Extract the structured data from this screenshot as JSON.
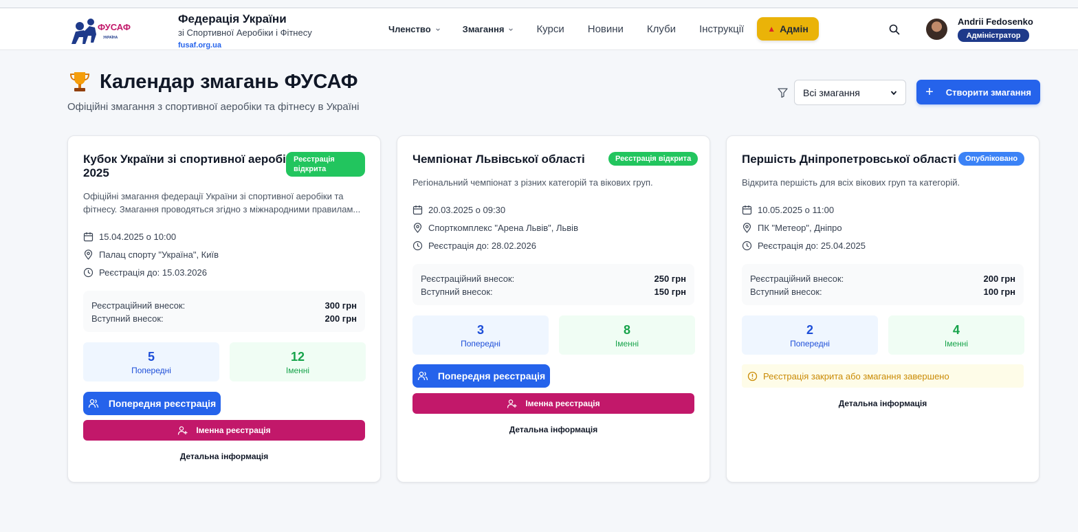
{
  "header": {
    "logo_text": "ФУСАФ",
    "logo_sub": "УКРАЇНА",
    "brand_title": "Федерація України",
    "brand_subtitle": "зі Спортивної Аеробіки і Фітнесу",
    "brand_url": "fusaf.org.ua",
    "nav": {
      "membership": "Членство",
      "competitions": "Змагання",
      "courses": "Курси",
      "news": "Новини",
      "clubs": "Клуби",
      "instructions": "Інструкції"
    },
    "admin_label": "Адмін",
    "user_name": "Andrii Fedosenko",
    "user_role": "Адміністратор"
  },
  "page": {
    "title": "Календар змагань ФУСАФ",
    "subtitle": "Офіційні змагання з спортивної аеробіки та фітнесу в Україні",
    "filter_selected": "Всі змагання",
    "create_label": "Створити змагання"
  },
  "labels": {
    "fee_registration": "Реєстраційний внесок:",
    "fee_entry": "Вступний внесок:",
    "stat_preliminary": "Попередні",
    "stat_named": "Іменні",
    "btn_preliminary": "Попередня реєстрація",
    "btn_named": "Іменна реєстрація",
    "details": "Детальна інформація"
  },
  "cards": [
    {
      "title_line1": "Кубок України зі спортивної аеробіки",
      "title_line2": "2025",
      "badge_line1": "Реєстрація",
      "badge_line2": "відкрита",
      "status_color": "#22c55e",
      "desc_line1": "Офіційні змагання федерації України зі спортивної аеробіки та",
      "desc_line2": "фітнесу. Змагання проводяться згідно з міжнародними правилам...",
      "date": "15.04.2025 о 10:00",
      "location": "Палац спорту \"Україна\", Київ",
      "deadline": "Реєстрація до: 15.03.2026",
      "fee_registration": "300 грн",
      "fee_entry": "200 грн",
      "preliminary_count": "5",
      "named_count": "12"
    },
    {
      "title_line1": "Чемпіонат Львівської області",
      "badge": "Реєстрація відкрита",
      "status_color": "#22c55e",
      "desc": "Регіональний чемпіонат з різних категорій та вікових груп.",
      "date": "20.03.2025 о 09:30",
      "location": "Спорткомплекс \"Арена Львів\", Львів",
      "deadline": "Реєстрація до: 28.02.2026",
      "fee_registration": "250 грн",
      "fee_entry": "150 грн",
      "preliminary_count": "3",
      "named_count": "8"
    },
    {
      "title_line1": "Першість Дніпропетровської області",
      "badge": "Опубліковано",
      "status_color": "#3b82f6",
      "desc": "Відкрита першість для всіх вікових груп та категорій.",
      "date": "10.05.2025 о 11:00",
      "location": "ПК \"Метеор\", Дніпро",
      "deadline": "Реєстрація до: 25.04.2025",
      "fee_registration": "200 грн",
      "fee_entry": "100 грн",
      "preliminary_count": "2",
      "named_count": "4",
      "closed_notice": "Реєстрація закрита або змагання завершено"
    }
  ],
  "colors": {
    "primary": "#2563eb",
    "named_button": "#c2186a",
    "admin": "#eab308",
    "role_badge": "#1e3a8a"
  }
}
